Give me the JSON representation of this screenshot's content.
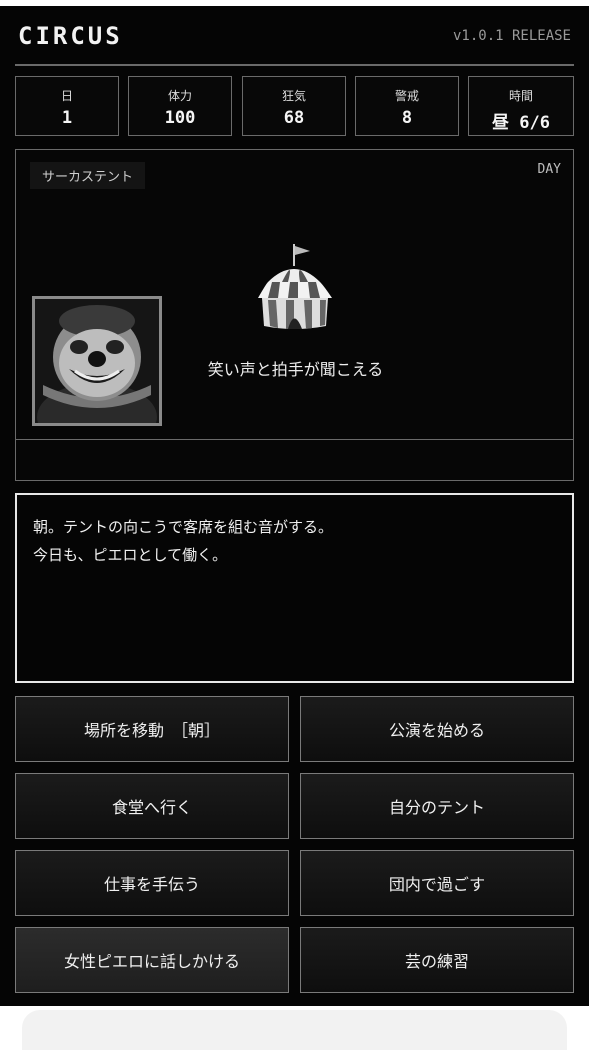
{
  "header": {
    "title": "CIRCUS",
    "version": "v1.0.1 RELEASE"
  },
  "stats": [
    {
      "label": "日",
      "value": "1"
    },
    {
      "label": "体力",
      "value": "100"
    },
    {
      "label": "狂気",
      "value": "68"
    },
    {
      "label": "警戒",
      "value": "8"
    },
    {
      "label": "時間",
      "value": "昼 6/6"
    }
  ],
  "scene": {
    "location": "サーカステント",
    "phase": "DAY",
    "icon": "circus-tent-icon",
    "portrait": "clown-portrait",
    "text": "笑い声と拍手が聞こえる"
  },
  "message": {
    "lines": [
      "朝。テントの向こうで客席を組む音がする。",
      "今日も、ピエロとして働く。"
    ]
  },
  "actions": [
    {
      "label": "場所を移動　［朝］"
    },
    {
      "label": "公演を始める"
    },
    {
      "label": "食堂へ行く"
    },
    {
      "label": "自分のテント"
    },
    {
      "label": "仕事を手伝う"
    },
    {
      "label": "団内で過ごす"
    },
    {
      "label": "女性ピエロに話しかける"
    },
    {
      "label": "芸の練習"
    }
  ]
}
